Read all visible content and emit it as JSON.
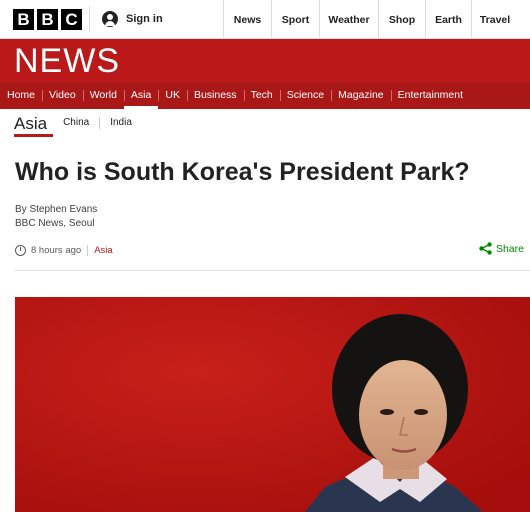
{
  "colors": {
    "brand_red": "#bb1919",
    "nav_red": "#a91717",
    "share_green": "#008800"
  },
  "topbar": {
    "logo": [
      "B",
      "B",
      "C"
    ],
    "signin": {
      "icon": "user-icon",
      "label": "Sign in"
    },
    "links": [
      "News",
      "Sport",
      "Weather",
      "Shop",
      "Earth",
      "Travel"
    ]
  },
  "masthead": {
    "title": "NEWS"
  },
  "nav": {
    "items": [
      "Home",
      "Video",
      "World",
      "Asia",
      "UK",
      "Business",
      "Tech",
      "Science",
      "Magazine",
      "Entertainment"
    ],
    "active": "Asia"
  },
  "subnav": {
    "title": "Asia",
    "items": [
      "China",
      "India"
    ]
  },
  "article": {
    "headline": "Who is South Korea's President Park?",
    "author": "By Stephen Evans",
    "bureau": "BBC News, Seoul",
    "timestamp": "8 hours ago",
    "section_tag": "Asia",
    "share_label": "Share",
    "image": {
      "subject": "portrait-photo",
      "background": "#b5110f"
    }
  }
}
